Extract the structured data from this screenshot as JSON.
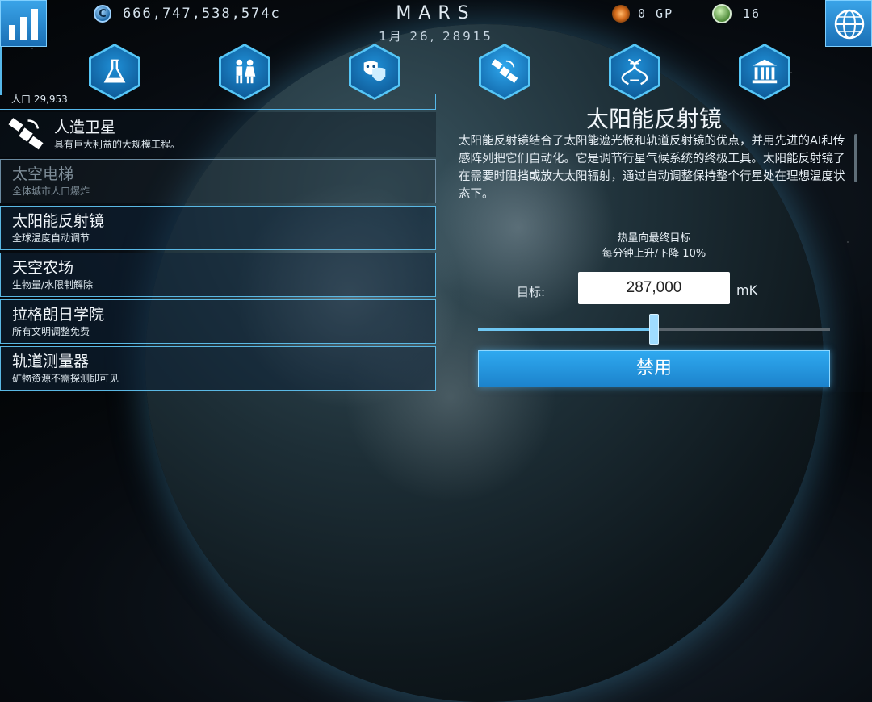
{
  "header": {
    "credits": "666,747,538,574c",
    "planet_name": "MARS",
    "date": "1月 26, 28915",
    "gp": "0 GP",
    "leaves": "16"
  },
  "population": "人口 29,953",
  "list": {
    "selected": {
      "title": "人造卫星",
      "desc": "具有巨大利益的大规模工程。"
    },
    "items": [
      {
        "title": "太空电梯",
        "desc": "全体城市人口爆炸",
        "disabled": true
      },
      {
        "title": "太阳能反射镜",
        "desc": "全球温度自动调节"
      },
      {
        "title": "天空农场",
        "desc": "生物量/水限制解除"
      },
      {
        "title": "拉格朗日学院",
        "desc": "所有文明调整免费"
      },
      {
        "title": "轨道测量器",
        "desc": "矿物资源不需探测即可见"
      }
    ]
  },
  "detail": {
    "title": "太阳能反射镜",
    "description": "太阳能反射镜结合了太阳能遮光板和轨道反射镜的优点，并用先进的AI和传感阵列把它们自动化。它是调节行星气候系统的终极工具。太阳能反射镜了在需要时阻挡或放大太阳辐射，通过自动调整保持整个行星处在理想温度状态下。",
    "heat_label": "热量向最终目标",
    "heat_rate": "每分钟上升/下降 10%",
    "target_label": "目标:",
    "target_value": "287,000",
    "target_unit": "mK",
    "slider_fraction": 0.5,
    "disable_button": "禁用"
  },
  "colors": {
    "accent": "#2fa9f0",
    "hex_border": "#55c6f7"
  }
}
